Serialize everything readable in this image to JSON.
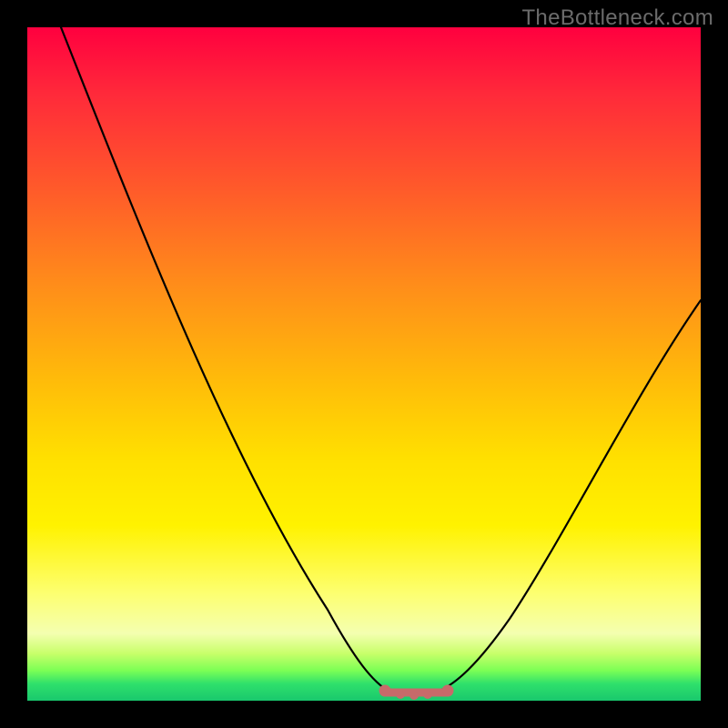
{
  "watermark": "TheBottleneck.com",
  "colors": {
    "page_bg": "#000000",
    "curve_stroke": "#000000",
    "bottom_marker": "#cc6666",
    "gradient_stops": [
      "#ff003f",
      "#ff2a3a",
      "#ff5a2a",
      "#ff8c1a",
      "#ffba0a",
      "#ffe000",
      "#fff200",
      "#fdff70",
      "#f4ffb0",
      "#c8ff6a",
      "#7cff55",
      "#2fe06b",
      "#19c86d"
    ]
  },
  "chart_data": {
    "type": "line",
    "title": "",
    "xlabel": "",
    "ylabel": "",
    "xlim": [
      0,
      100
    ],
    "ylim": [
      0,
      100
    ],
    "grid": false,
    "legend": null,
    "note": "Axis values are normalized 0–100; chart has no visible tick labels.",
    "series": [
      {
        "name": "bottleneck-curve",
        "x": [
          5,
          10,
          15,
          20,
          25,
          30,
          35,
          40,
          45,
          50,
          52,
          54,
          56,
          58,
          60,
          62,
          65,
          70,
          75,
          80,
          85,
          90,
          95,
          100
        ],
        "y": [
          100,
          90,
          80,
          70,
          60,
          50,
          41,
          32,
          23,
          14,
          9,
          5,
          2,
          1,
          1,
          2,
          4,
          9,
          16,
          24,
          32,
          41,
          50,
          59
        ]
      }
    ],
    "annotations": [
      {
        "name": "optimal-range-marker",
        "type": "segment",
        "x": [
          53,
          63
        ],
        "y": [
          1,
          1
        ]
      }
    ]
  }
}
